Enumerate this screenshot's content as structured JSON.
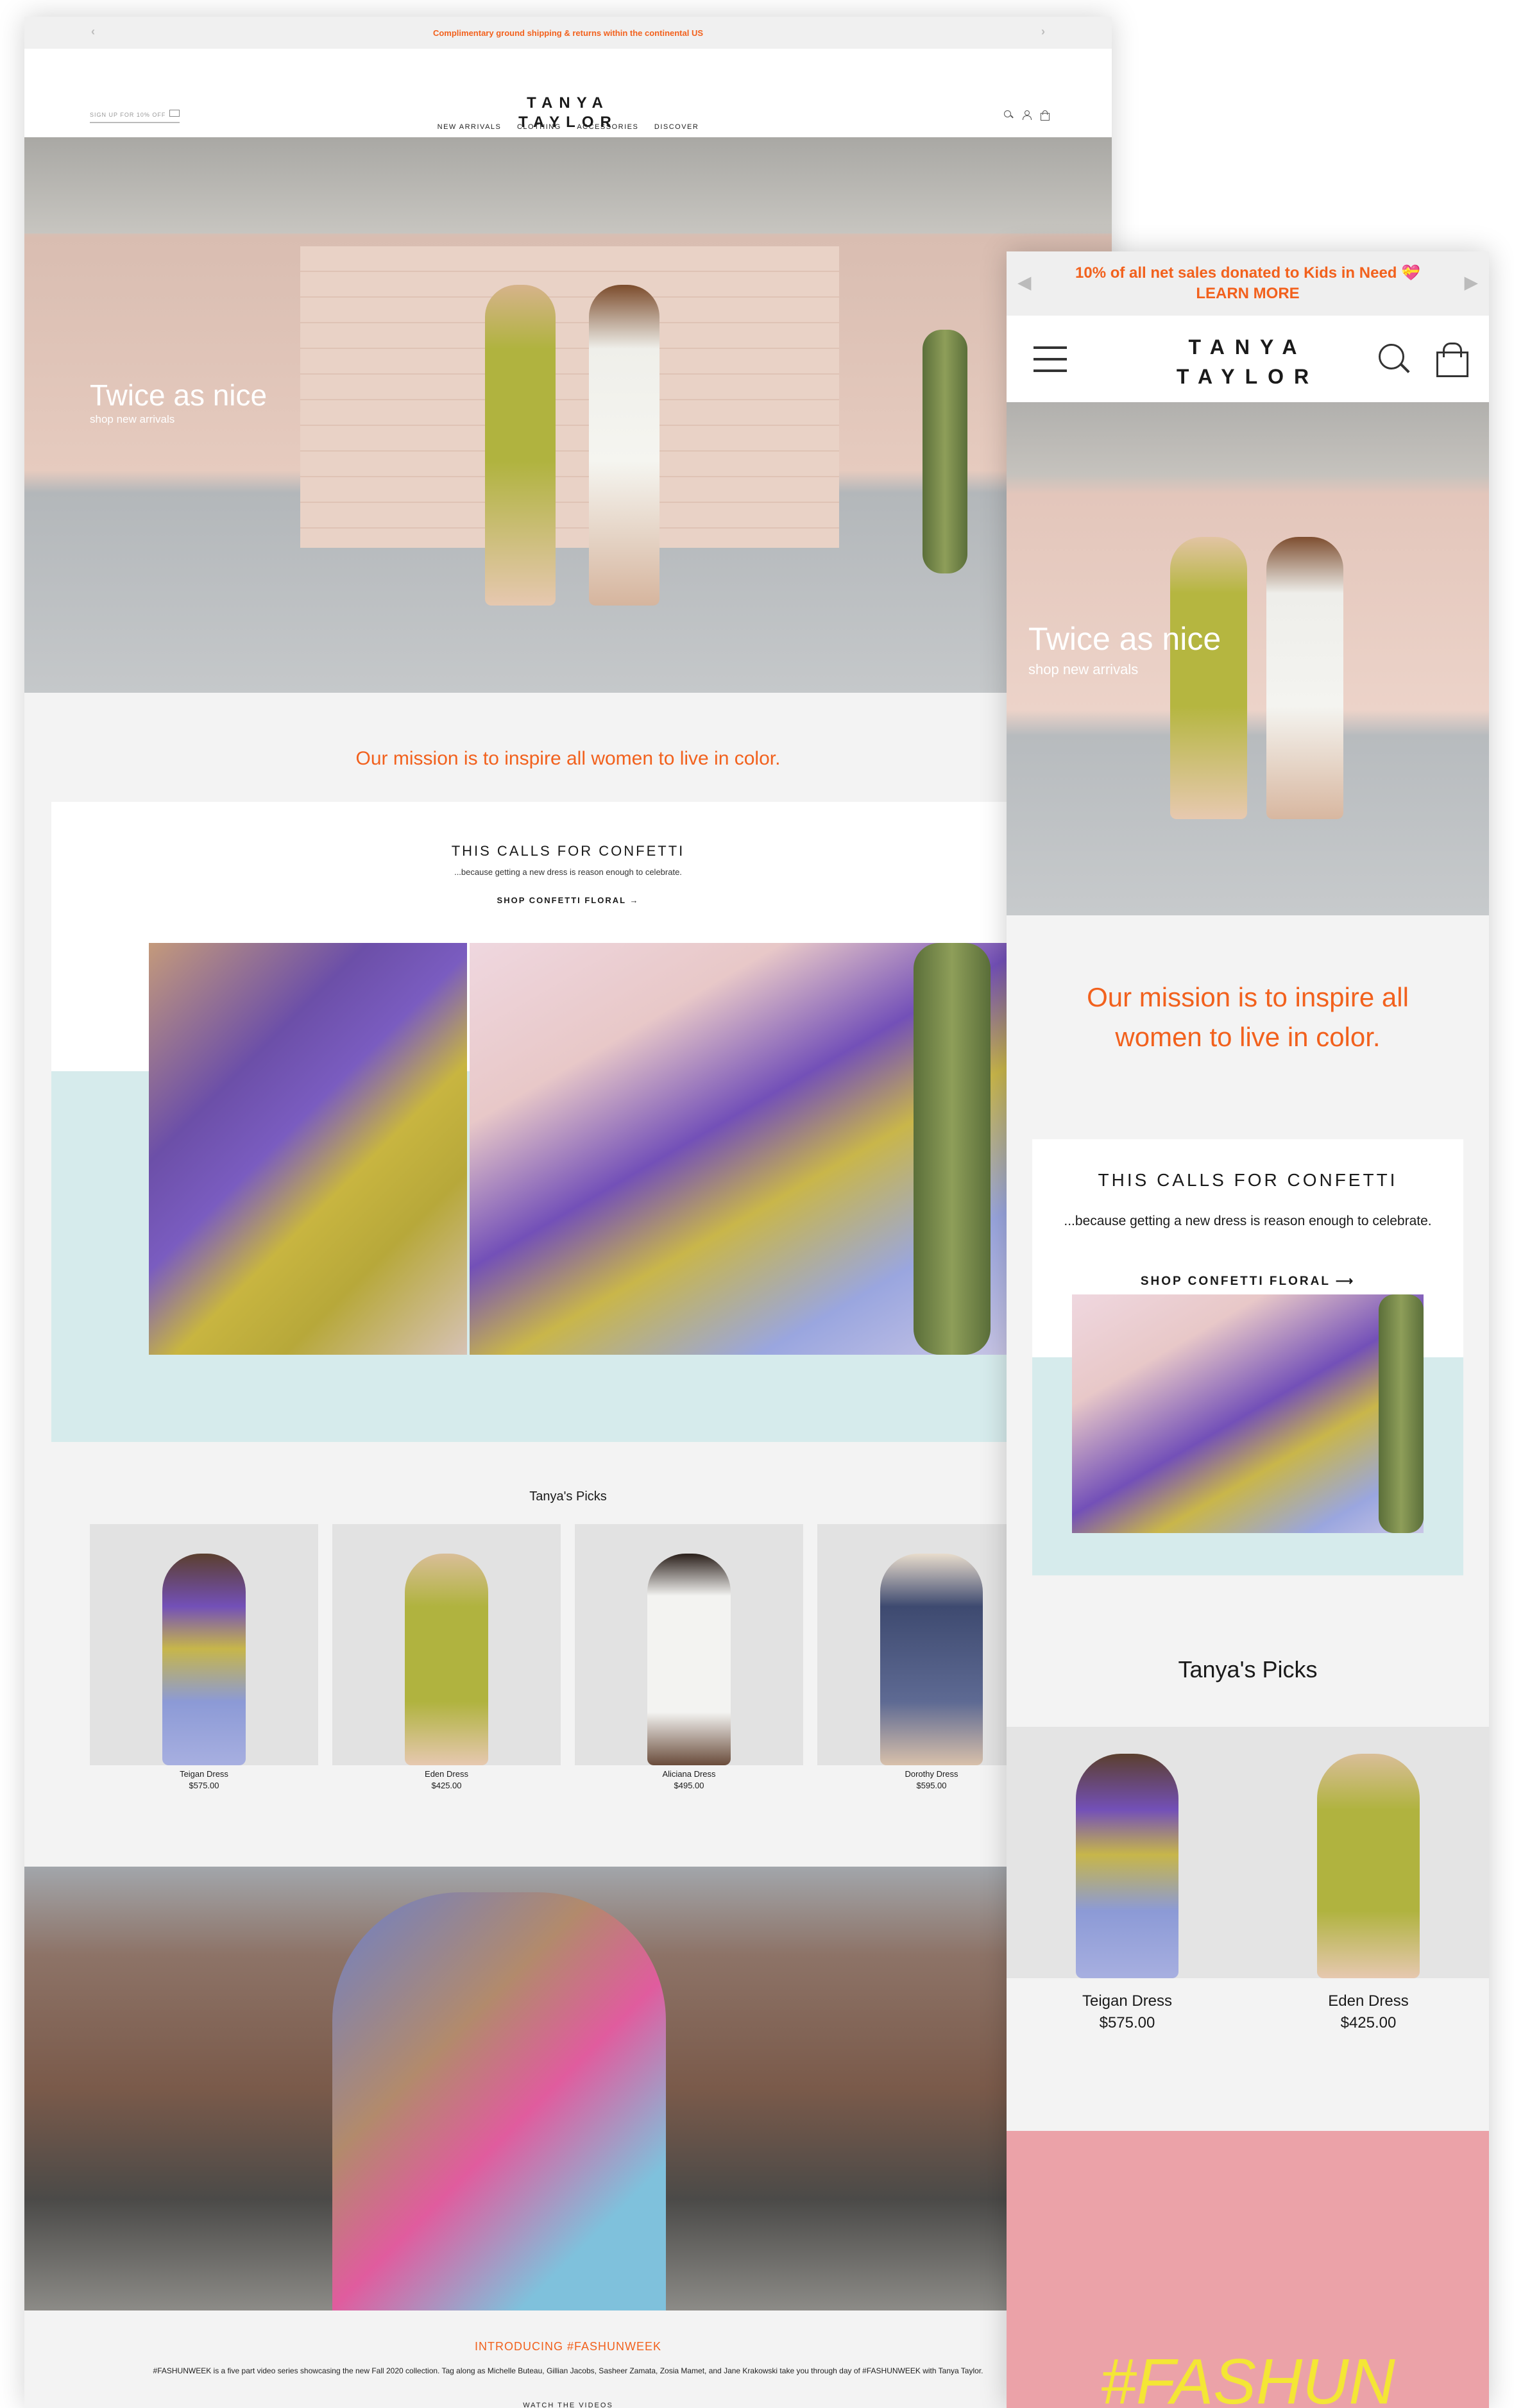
{
  "desktop": {
    "promo": "Complimentary ground shipping & returns within the continental US",
    "signup": "SIGN UP FOR 10% OFF",
    "logo_line1": "TANYA",
    "logo_line2": "TAYLOR",
    "nav": [
      "NEW ARRIVALS",
      "CLOTHING",
      "ACCESSORIES",
      "DISCOVER"
    ],
    "hero_title": "Twice as nice",
    "hero_sub": "shop new arrivals",
    "mission": "Our mission is to inspire all women to live in color.",
    "confetti_title": "THIS CALLS FOR CONFETTI",
    "confetti_sub": "...because getting a new dress is reason enough to celebrate.",
    "confetti_link": "SHOP CONFETTI FLORAL →",
    "picks_title": "Tanya's Picks",
    "picks": [
      {
        "name": "Teigan Dress",
        "price": "$575.00"
      },
      {
        "name": "Eden Dress",
        "price": "$425.00"
      },
      {
        "name": "Aliciana Dress",
        "price": "$495.00"
      },
      {
        "name": "Dorothy Dress",
        "price": "$595.00"
      }
    ],
    "fashun_intro": "INTRODUCING #FASHUNWEEK",
    "fashun_body": "#FASHUNWEEK is a five part video series showcasing the new Fall 2020 collection. Tag along as Michelle Buteau, Gillian Jacobs, Sasheer Zamata, Zosia Mamet, and Jane Krakowski take you through day of #FASHUNWEEK with Tanya Taylor.",
    "fashun_watch": "WATCH THE VIDEOS"
  },
  "mobile": {
    "promo_line1": "10% of all net sales donated to Kids in Need 💝",
    "promo_line2": "LEARN MORE",
    "logo_line1": "TANYA",
    "logo_line2": "TAYLOR",
    "hero_title": "Twice as nice",
    "hero_sub": "shop new arrivals",
    "mission": "Our mission is to inspire all women to live in color.",
    "confetti_title": "THIS CALLS FOR CONFETTI",
    "confetti_sub": "...because getting a new dress is reason enough to celebrate.",
    "confetti_link": "SHOP CONFETTI FLORAL ⟶",
    "picks_title": "Tanya's Picks",
    "picks": [
      {
        "name": "Teigan Dress",
        "price": "$575.00"
      },
      {
        "name": "Eden Dress",
        "price": "$425.00"
      }
    ],
    "fashun_banner": "#FASHUN"
  },
  "colors": {
    "accent": "#f2611d",
    "teal_band": "#d6ebec",
    "pink_band": "#eba2a8",
    "fashun_yellow": "#f4e635"
  }
}
